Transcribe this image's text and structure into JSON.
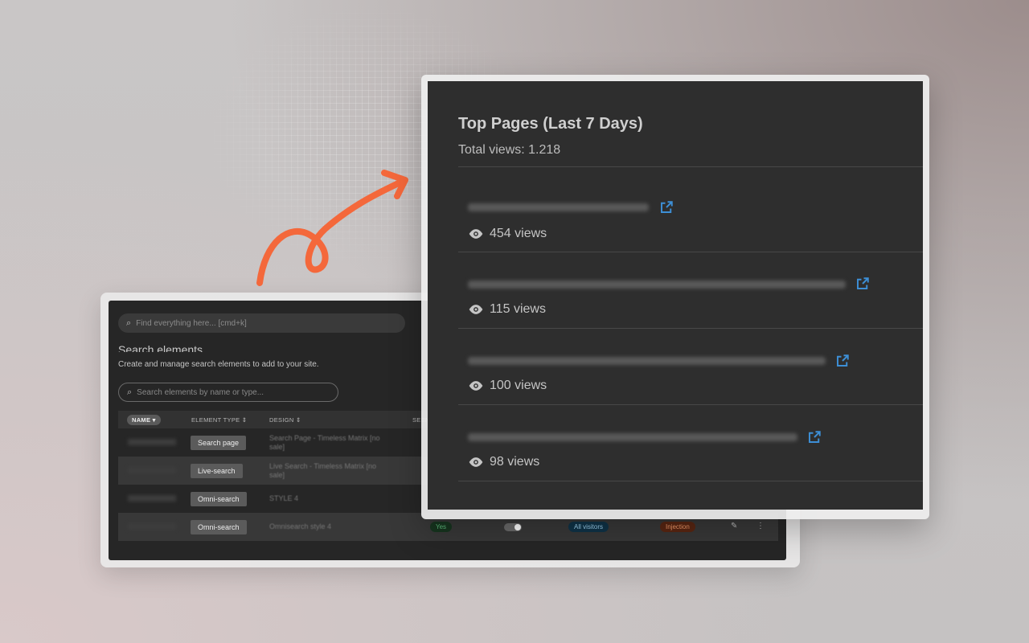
{
  "back_window": {
    "global_search_placeholder": "Find everything here... [cmd+k]",
    "section_title": "Search elements",
    "section_subtitle": "Create and manage search elements to add to your site.",
    "element_search_placeholder": "Search elements by name or type...",
    "columns": {
      "name": "NAME ▾",
      "element_type": "ELEMENT TYPE ⇕",
      "design": "DESIGN ⇕",
      "seen": "SEEN"
    },
    "rows": [
      {
        "type": "Search page",
        "design": "Search Page - Timeless Matrix [no sale]"
      },
      {
        "type": "Live-search",
        "design": "Live Search - Timeless Matrix [no sale]"
      },
      {
        "type": "Omni-search",
        "design": "STYLE 4"
      },
      {
        "type": "Omni-search",
        "design": "Omnisearch style 4",
        "seen": "Yes",
        "audience": "All visitors",
        "method": "Injection"
      }
    ]
  },
  "front_panel": {
    "title": "Top Pages (Last 7 Days)",
    "total": "Total views: 1.218",
    "pages": [
      {
        "views": "454 views"
      },
      {
        "views": "115 views"
      },
      {
        "views": "100 views"
      },
      {
        "views": "98 views"
      }
    ],
    "colors": {
      "link_icon": "#3d8fd6",
      "arrow": "#f4683b"
    }
  }
}
